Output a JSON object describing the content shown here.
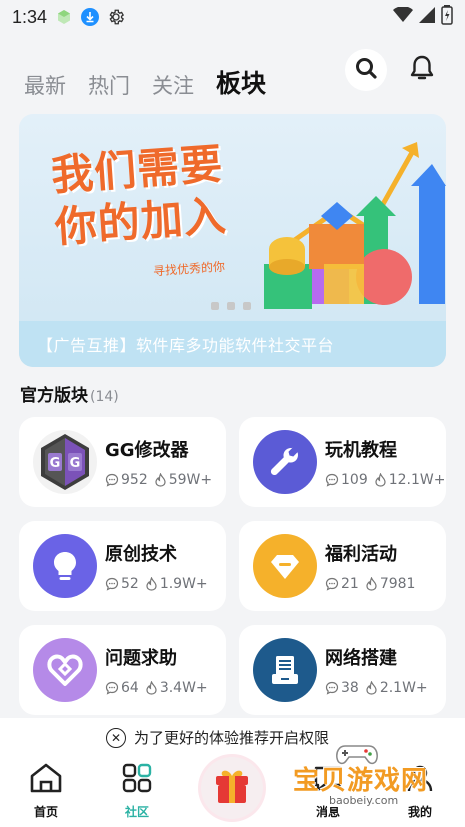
{
  "status": {
    "time": "1:34"
  },
  "tabs": [
    {
      "label": "最新"
    },
    {
      "label": "热门"
    },
    {
      "label": "关注"
    },
    {
      "label": "板块"
    }
  ],
  "banner": {
    "headline_line1": "我们需要",
    "headline_line2": "你的加入",
    "subtitle": "寻找优秀的你",
    "caption": "【广告互推】软件库多功能软件社交平台"
  },
  "section": {
    "title": "官方版块",
    "count": "(14)"
  },
  "boards": [
    {
      "name": "GG修改器",
      "posts": "952",
      "heat": "59W+",
      "icon": "gg-logo-icon",
      "color": "#6b4fa0"
    },
    {
      "name": "玩机教程",
      "posts": "109",
      "heat": "12.1W+",
      "icon": "wrench-icon",
      "color": "#5b5bd6"
    },
    {
      "name": "原创技术",
      "posts": "52",
      "heat": "1.9W+",
      "icon": "lightbulb-icon",
      "color": "#6a63e6"
    },
    {
      "name": "福利活动",
      "posts": "21",
      "heat": "7981",
      "icon": "gem-icon",
      "color": "#f5b12b"
    },
    {
      "name": "问题求助",
      "posts": "64",
      "heat": "3.4W+",
      "icon": "heart-help-icon",
      "color": "#b58ae8"
    },
    {
      "name": "网络搭建",
      "posts": "38",
      "heat": "2.1W+",
      "icon": "server-icon",
      "color": "#1e5a8c"
    }
  ],
  "permission": {
    "text": "为了更好的体验推荐开启权限"
  },
  "bottom_nav": [
    {
      "label": "首页"
    },
    {
      "label": "社区"
    },
    {
      "label": "消息"
    },
    {
      "label": "我的"
    }
  ],
  "watermark": {
    "title": "宝贝游戏网",
    "url": "baobeiy.com"
  }
}
